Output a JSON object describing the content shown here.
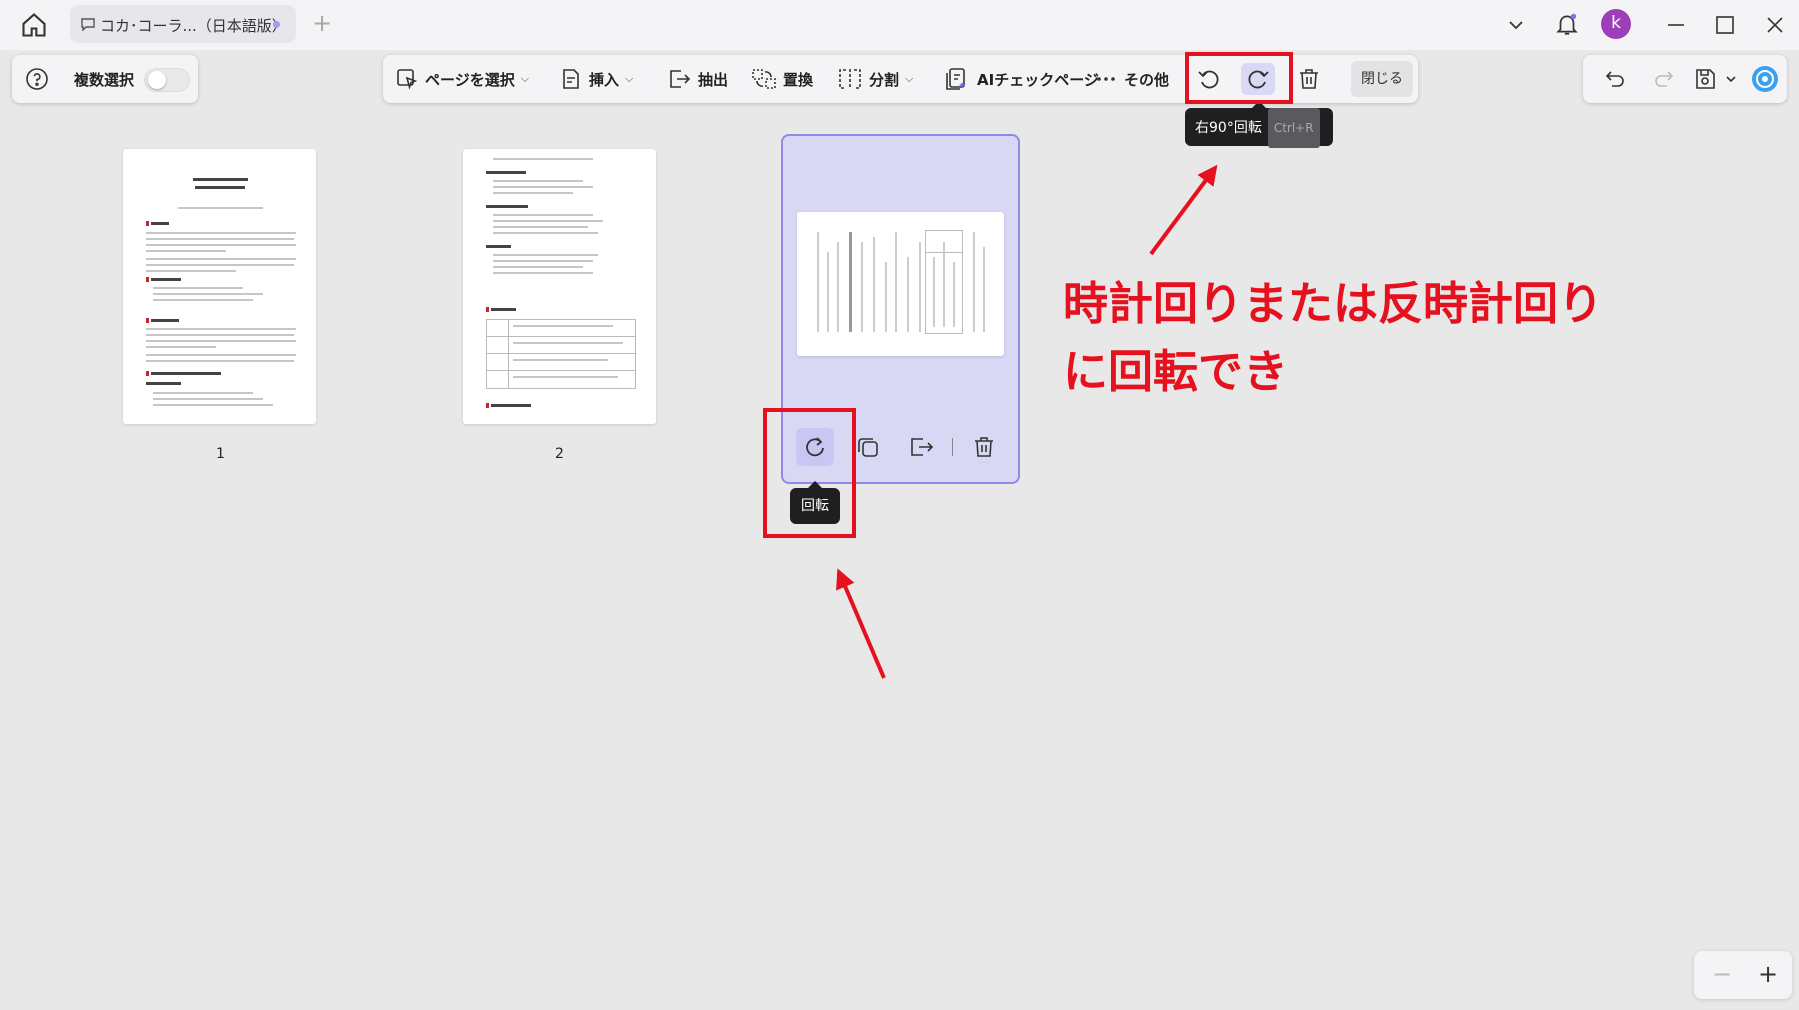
{
  "window": {
    "tab_title": "コカ･コーラ...（日本語版）",
    "tab_add": "+",
    "avatar_letter": "k"
  },
  "toolbar_left": {
    "multi_select_label": "複数選択"
  },
  "toolbar": {
    "select_page": "ページを選択",
    "insert": "挿入",
    "extract": "抽出",
    "replace": "置換",
    "split": "分割",
    "ai_check": "AIチェックページ",
    "more": "その他",
    "close": "閉じる"
  },
  "tooltip_rotate_right": {
    "label": "右90°回転",
    "shortcut": "Ctrl+R"
  },
  "tooltip_rotate": {
    "label": "回転"
  },
  "pages": [
    {
      "number": "1"
    },
    {
      "number": "2"
    }
  ],
  "annotation": {
    "line1": "時計回りまたは反時計回り",
    "line2": "に回転でき"
  },
  "zoom": {
    "minus": "−",
    "plus": "+"
  },
  "colors": {
    "accent": "#8f89ea",
    "annotation_red": "#e6111f",
    "avatar": "#9c3fb8"
  }
}
